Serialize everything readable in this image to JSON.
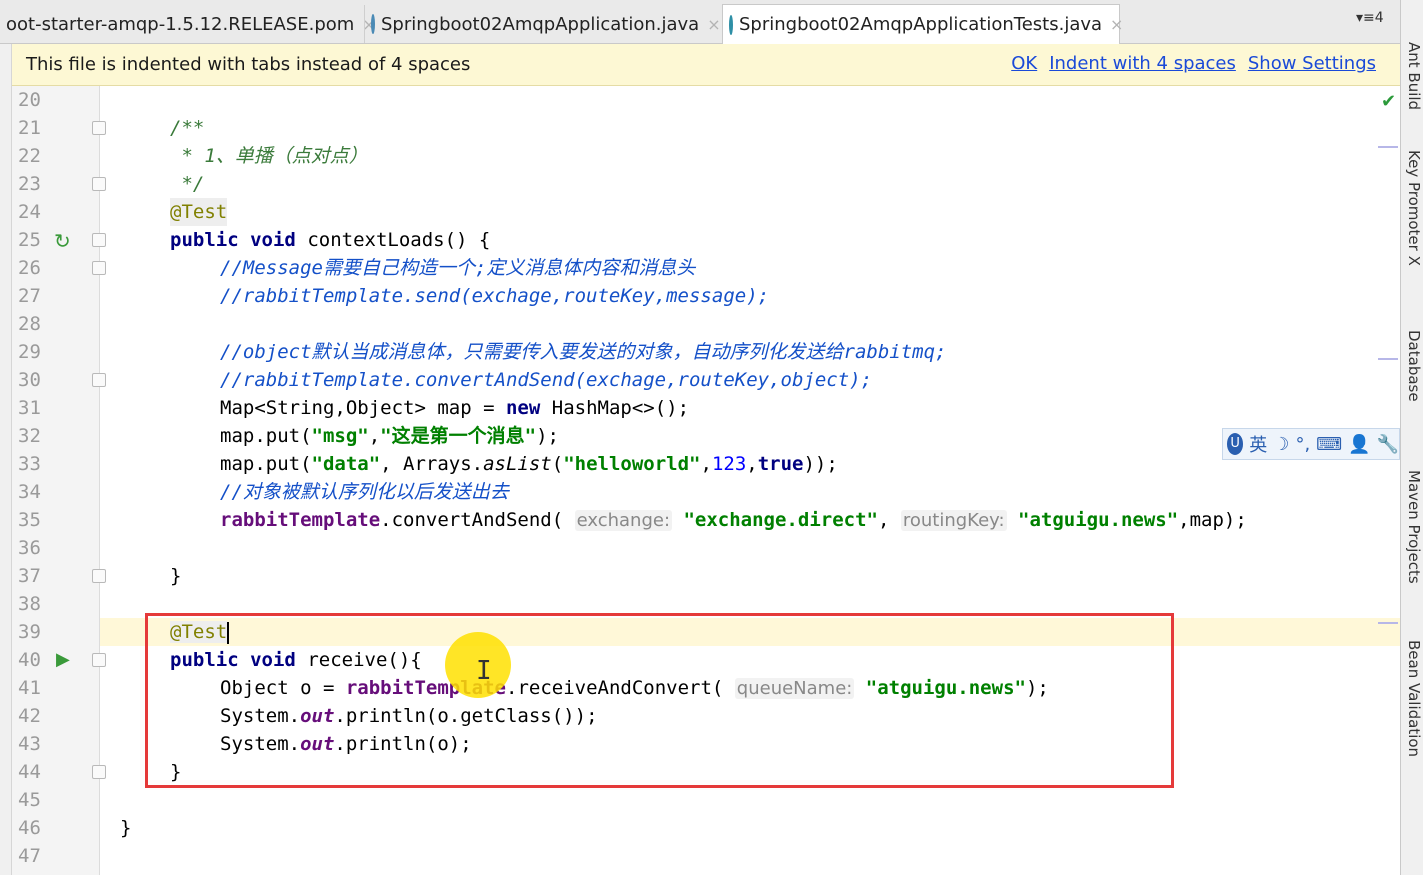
{
  "tabs": [
    {
      "label": "oot-starter-amqp-1.5.12.RELEASE.pom",
      "close": "×"
    },
    {
      "label": "Springboot02AmqpApplication.java",
      "close": "×"
    },
    {
      "label": "Springboot02AmqpApplicationTests.java",
      "close": "×"
    }
  ],
  "tab_overflow": "▾≡4",
  "notification": {
    "message": "This file is indented with tabs instead of 4 spaces",
    "ok": "OK",
    "indent": "Indent with 4 spaces",
    "settings": "Show Settings"
  },
  "line_numbers": [
    "20",
    "21",
    "22",
    "23",
    "24",
    "25",
    "26",
    "27",
    "28",
    "29",
    "30",
    "31",
    "32",
    "33",
    "34",
    "35",
    "36",
    "37",
    "38",
    "39",
    "40",
    "41",
    "42",
    "43",
    "44",
    "45",
    "46",
    "47"
  ],
  "code": {
    "l21": "/**",
    "l22": " * 1、单播（点对点）",
    "l23": " */",
    "l24": "@Test",
    "l25_kw1": "public",
    "l25_kw2": "void",
    "l25_rest": "contextLoads() {",
    "l26": "//Message需要自己构造一个;定义消息体内容和消息头",
    "l27": "//rabbitTemplate.send(exchage,routeKey,message);",
    "l29": "//object默认当成消息体，只需要传入要发送的对象，自动序列化发送给rabbitmq;",
    "l30": "//rabbitTemplate.convertAndSend(exchage,routeKey,object);",
    "l31_a": "Map<String,Object> map = ",
    "l31_kw": "new",
    "l31_b": " HashMap<>();",
    "l32_a": "map.put(",
    "l32_s1": "\"msg\"",
    "l32_comma": ",",
    "l32_s2": "\"这是第一个消息\"",
    "l32_end": ");",
    "l33_a": "map.put(",
    "l33_s1": "\"data\"",
    "l33_b": ", Arrays.",
    "l33_method": "asList",
    "l33_c": "(",
    "l33_s2": "\"helloworld\"",
    "l33_d": ",",
    "l33_num": "123",
    "l33_e": ",",
    "l33_kw": "true",
    "l33_end": "));",
    "l34": "//对象被默认序列化以后发送出去",
    "l35_field": "rabbitTemplate",
    "l35_a": ".convertAndSend( ",
    "l35_hint1": "exchange:",
    "l35_s1": "\"exchange.direct\"",
    "l35_b": ", ",
    "l35_hint2": "routingKey:",
    "l35_s2": "\"atguigu.news\"",
    "l35_end": ",map);",
    "l37": "}",
    "l39": "@Test",
    "l40_kw1": "public",
    "l40_kw2": "void",
    "l40_rest": "receive(){",
    "l41_a": "Object o = ",
    "l41_field": "rabbitTemplate",
    "l41_b": ".receiveAndConvert( ",
    "l41_hint": "queueName:",
    "l41_s": "\"atguigu.news\"",
    "l41_end": ");",
    "l42_a": "System.",
    "l42_static": "out",
    "l42_b": ".println(o.getClass());",
    "l43_a": "System.",
    "l43_static": "out",
    "l43_b": ".println(o);",
    "l44": "}",
    "l46": "}"
  },
  "right_panels": [
    "Ant Build",
    "Key Promoter X",
    "Database",
    "Maven Projects",
    "Bean Validation"
  ],
  "ime": [
    "英",
    "☽",
    "°,",
    "⌨",
    "👤",
    "🔧"
  ],
  "colors": {
    "keyword": "#000080",
    "annotation": "#808000",
    "comment": "#1450c8",
    "string": "#008000",
    "highlight_box": "#e53a3a",
    "notification_bg": "#fdf8d4"
  }
}
